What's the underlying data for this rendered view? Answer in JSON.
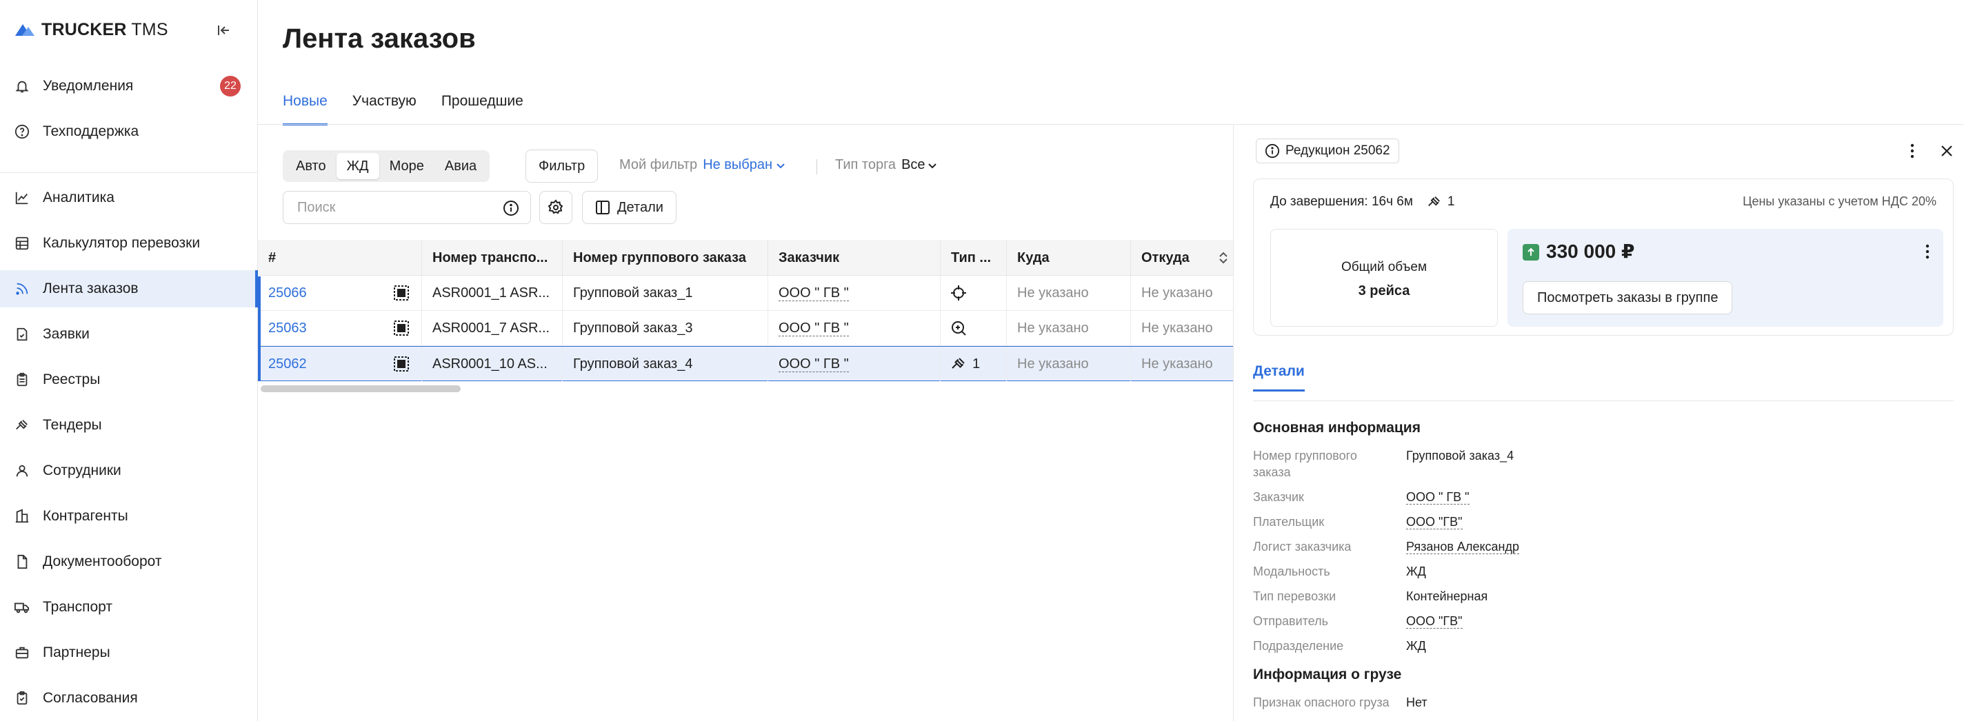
{
  "brand": {
    "name_bold": "TRUCKER",
    "name_regular": " TMS"
  },
  "sidebar": {
    "items": [
      {
        "label": "Уведомления",
        "icon": "bell-icon",
        "badge": "22"
      },
      {
        "label": "Техподдержка",
        "icon": "help-icon"
      },
      {
        "label": "Аналитика",
        "icon": "chart-icon"
      },
      {
        "label": "Калькулятор перевозки",
        "icon": "calculator-icon"
      },
      {
        "label": "Лента заказов",
        "icon": "feed-icon",
        "active": true
      },
      {
        "label": "Заявки",
        "icon": "requests-icon"
      },
      {
        "label": "Реестры",
        "icon": "registry-icon"
      },
      {
        "label": "Тендеры",
        "icon": "gavel-icon"
      },
      {
        "label": "Сотрудники",
        "icon": "user-icon"
      },
      {
        "label": "Контрагенты",
        "icon": "building-icon"
      },
      {
        "label": "Документооборот",
        "icon": "document-icon"
      },
      {
        "label": "Транспорт",
        "icon": "truck-icon"
      },
      {
        "label": "Партнеры",
        "icon": "briefcase-icon"
      },
      {
        "label": "Согласования",
        "icon": "approval-icon"
      }
    ]
  },
  "page": {
    "title": "Лента заказов"
  },
  "tabs": [
    {
      "label": "Новые",
      "active": true
    },
    {
      "label": "Участвую"
    },
    {
      "label": "Прошедшие"
    }
  ],
  "toolbar": {
    "modes": [
      {
        "label": "Авто"
      },
      {
        "label": "ЖД",
        "active": true
      },
      {
        "label": "Море"
      },
      {
        "label": "Авиа"
      }
    ],
    "filter_label": "Фильтр",
    "my_filter_label": "Мой фильтр",
    "my_filter_value": "Не выбран",
    "trade_type_label": "Тип торга",
    "trade_type_value": "Все",
    "search_placeholder": "Поиск",
    "details_label": "Детали"
  },
  "table": {
    "columns": [
      "#",
      "Номер транспо...",
      "Номер группового заказа",
      "Заказчик",
      "Тип ...",
      "Куда",
      "Откуда"
    ],
    "rows": [
      {
        "id": "25066",
        "transport": "ASR0001_1 ASR...",
        "group": "Групповой заказ_1",
        "customer": "ООО \" ГВ \"",
        "type_icon": "crosshair-icon",
        "type_text": "",
        "to": "Не указано",
        "from": "Не указано"
      },
      {
        "id": "25063",
        "transport": "ASR0001_7 ASR...",
        "group": "Групповой заказ_3",
        "customer": "ООО \" ГВ \"",
        "type_icon": "search-zoom-icon",
        "type_text": "",
        "to": "Не указано",
        "from": "Не указано"
      },
      {
        "id": "25062",
        "transport": "ASR0001_10 AS...",
        "group": "Групповой заказ_4",
        "customer": "ООО \" ГВ \"",
        "type_icon": "gavel-icon",
        "type_text": "1",
        "to": "Не указано",
        "from": "Не указано",
        "selected": true
      }
    ]
  },
  "panel": {
    "chip": "Редукцион 25062",
    "remaining": "До завершения: 16ч 6м",
    "bids": "1",
    "vat_note": "Цены указаны с учетом НДС 20%",
    "volume_label": "Общий объем",
    "volume_value": "3 рейса",
    "price": "330 000 ₽",
    "view_orders_label": "Посмотреть заказы в группе",
    "details_tab": "Детали",
    "section_main": "Основная информация",
    "fields": [
      {
        "label": "Номер группового заказа",
        "value": "Групповой заказ_4"
      },
      {
        "label": "Заказчик",
        "value": "ООО \" ГВ \"",
        "underline": true
      },
      {
        "label": "Плательщик",
        "value": "ООО \"ГВ\"",
        "underline": true
      },
      {
        "label": "Логист заказчика",
        "value": "Рязанов Александр",
        "underline": true
      },
      {
        "label": "Модальность",
        "value": "ЖД"
      },
      {
        "label": "Тип перевозки",
        "value": "Контейнерная"
      },
      {
        "label": "Отправитель",
        "value": "ООО \"ГВ\"",
        "underline": true
      },
      {
        "label": "Подразделение",
        "value": "ЖД"
      }
    ],
    "section_cargo": "Информация о грузе",
    "cargo_fields": [
      {
        "label": "Признак опасного груза",
        "value": "Нет"
      }
    ]
  },
  "colors": {
    "accent": "#2f6fdb",
    "badge": "#d64a4a",
    "price_up": "#3c9a5f",
    "selected_row": "#e8effb"
  }
}
